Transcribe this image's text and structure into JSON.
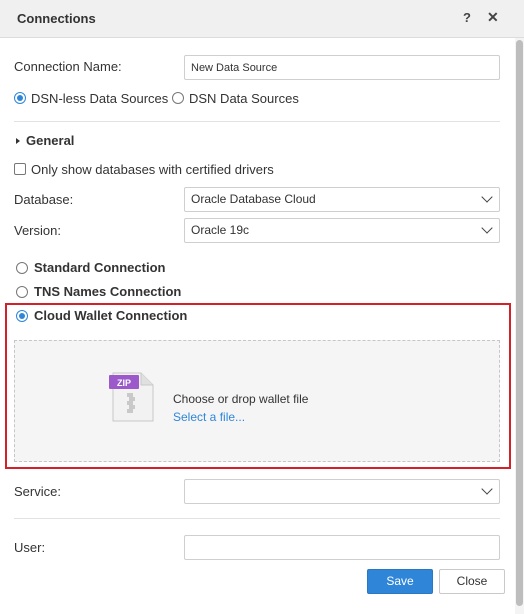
{
  "dialog": {
    "title": "Connections",
    "help_label": "?",
    "close_label": "✕"
  },
  "form": {
    "connection_name_label": "Connection Name:",
    "connection_name_value": "New Data Source",
    "source_type_options": [
      "DSN-less Data Sources",
      "DSN Data Sources"
    ],
    "source_type_selected": "DSN-less Data Sources",
    "section_general": "General",
    "certified_checkbox_label": "Only show databases with certified drivers",
    "certified_checked": false,
    "database_label": "Database:",
    "database_value": "Oracle Database Cloud",
    "version_label": "Version:",
    "version_value": "Oracle 19c",
    "connection_types": [
      "Standard Connection",
      "TNS Names Connection",
      "Cloud Wallet Connection"
    ],
    "connection_type_selected": "Cloud Wallet Connection",
    "dropzone": {
      "icon": "zip-file-icon",
      "icon_text": "ZIP",
      "text": "Choose or drop wallet file",
      "link": "Select a file..."
    },
    "service_label": "Service:",
    "service_value": "",
    "user_label": "User:",
    "user_value": ""
  },
  "footer": {
    "save_label": "Save",
    "close_label": "Close"
  },
  "colors": {
    "accent": "#2f86d8",
    "highlight_border": "#d32029",
    "zip_badge": "#9b59c9"
  }
}
